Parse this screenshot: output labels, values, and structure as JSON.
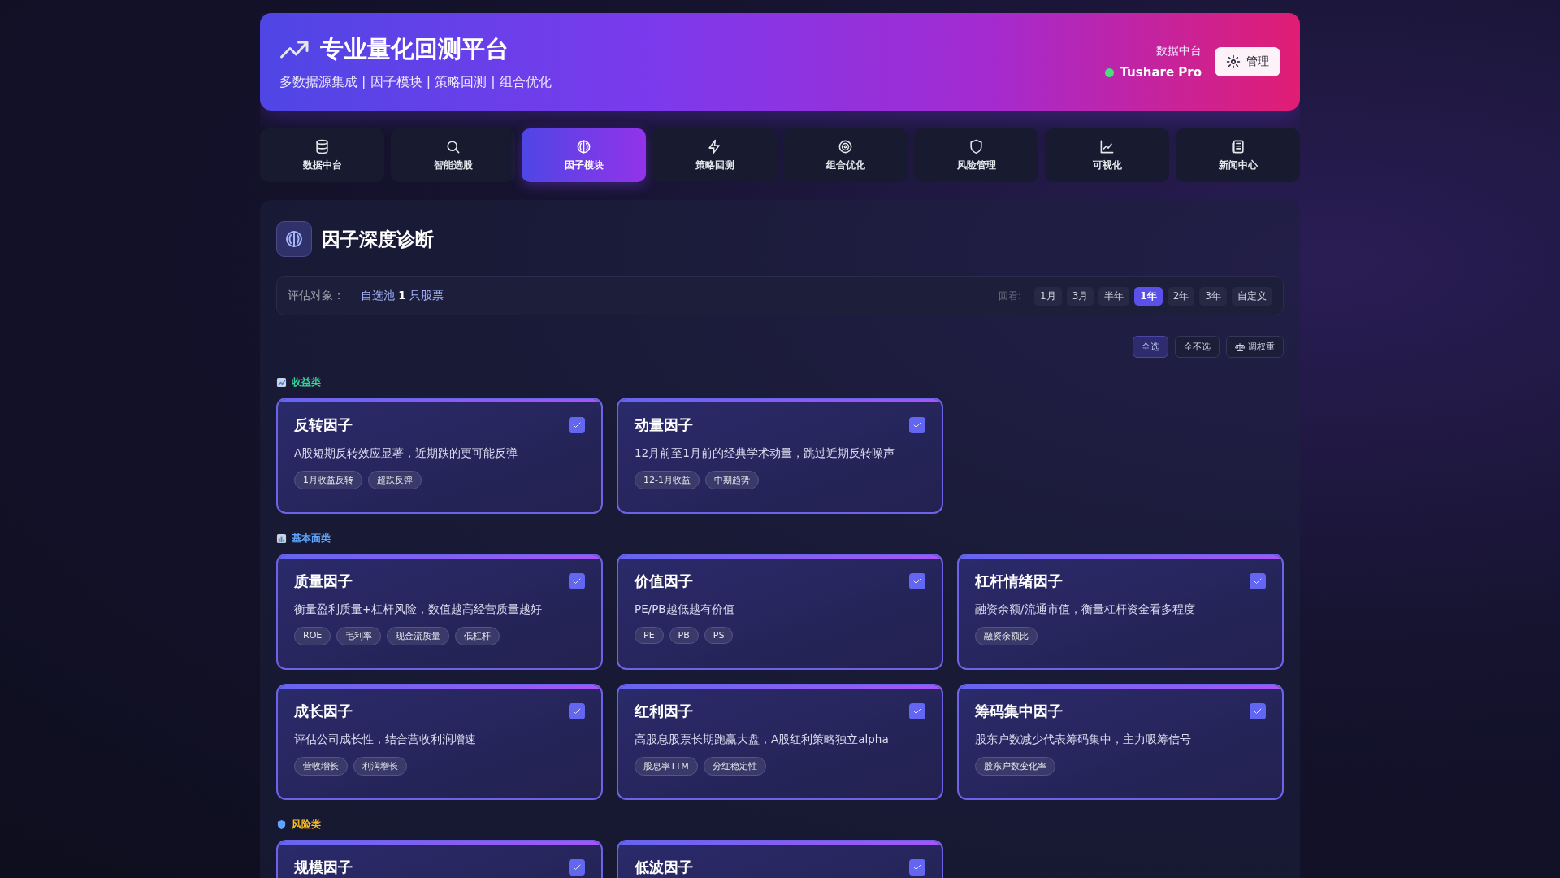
{
  "header": {
    "title": "专业量化回测平台",
    "subtitle": "多数据源集成 | 因子模块 | 策略回测 | 组合优化",
    "source_label": "数据中台",
    "source_name": "Tushare Pro",
    "source_online": true,
    "manage_button": "管理"
  },
  "tabs": [
    {
      "label": "数据中台",
      "selected": false
    },
    {
      "label": "智能选股",
      "selected": false
    },
    {
      "label": "因子模块",
      "selected": true
    },
    {
      "label": "策略回测",
      "selected": false
    },
    {
      "label": "组合优化",
      "selected": false
    },
    {
      "label": "风险管理",
      "selected": false
    },
    {
      "label": "可视化",
      "selected": false
    },
    {
      "label": "新闻中心",
      "selected": false
    }
  ],
  "panel": {
    "title": "因子深度诊断",
    "target_label": "评估对象：",
    "target_value": "自选池 **1** 只股票",
    "lookback_label": "回看:",
    "periods": [
      {
        "label": "1月",
        "selected": false
      },
      {
        "label": "3月",
        "selected": false
      },
      {
        "label": "半年",
        "selected": false
      },
      {
        "label": "1年",
        "selected": true
      },
      {
        "label": "2年",
        "selected": false
      },
      {
        "label": "3年",
        "selected": false
      },
      {
        "label": "自定义",
        "selected": false
      }
    ],
    "actions": [
      {
        "label": "全选",
        "selected": true
      },
      {
        "label": "全不选",
        "selected": false
      },
      {
        "label": "调权重",
        "selected": false
      }
    ],
    "groups": [
      {
        "name": "收益类",
        "color": "#34d399",
        "factors": [
          {
            "title": "反转因子",
            "checked": true,
            "description": "A股短期反转效应显著，近期跌的更可能反弹",
            "tags": [
              "1月收益反转",
              "超跌反弹"
            ]
          },
          {
            "title": "动量因子",
            "checked": true,
            "description": "12月前至1月前的经典学术动量，跳过近期反转噪声",
            "tags": [
              "12-1月收益",
              "中期趋势"
            ]
          }
        ]
      },
      {
        "name": "基本面类",
        "color": "#60a5fa",
        "factors": [
          {
            "title": "质量因子",
            "checked": true,
            "description": "衡量盈利质量+杠杆风险，数值越高经营质量越好",
            "tags": [
              "ROE",
              "毛利率",
              "现金流质量",
              "低杠杆"
            ]
          },
          {
            "title": "价值因子",
            "checked": true,
            "description": "PE/PB越低越有价值",
            "tags": [
              "PE",
              "PB",
              "PS"
            ]
          },
          {
            "title": "杠杆情绪因子",
            "checked": true,
            "description": "融资余额/流通市值，衡量杠杆资金看多程度",
            "tags": [
              "融资余额比"
            ]
          },
          {
            "title": "成长因子",
            "checked": true,
            "description": "评估公司成长性，结合营收利润增速",
            "tags": [
              "营收增长",
              "利润增长"
            ]
          },
          {
            "title": "红利因子",
            "checked": true,
            "description": "高股息股票长期跑赢大盘，A股红利策略独立alpha",
            "tags": [
              "股息率TTM",
              "分红稳定性"
            ]
          },
          {
            "title": "筹码集中因子",
            "checked": true,
            "description": "股东户数减少代表筹码集中，主力吸筹信号",
            "tags": [
              "股东户数变化率"
            ]
          }
        ]
      },
      {
        "name": "风险类",
        "color": "#fbbf24",
        "factors": [
          {
            "title": "规模因子",
            "checked": true
          },
          {
            "title": "低波因子",
            "checked": true
          }
        ]
      }
    ]
  }
}
